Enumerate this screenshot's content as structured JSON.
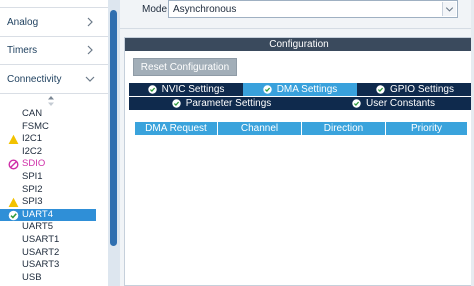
{
  "sidebar": {
    "categories": [
      {
        "label": "Analog"
      },
      {
        "label": "Timers"
      },
      {
        "label": "Connectivity"
      }
    ],
    "peripherals": [
      {
        "label": "CAN",
        "status": "none"
      },
      {
        "label": "FSMC",
        "status": "none"
      },
      {
        "label": "I2C1",
        "status": "warning"
      },
      {
        "label": "I2C2",
        "status": "none"
      },
      {
        "label": "SDIO",
        "status": "disabled"
      },
      {
        "label": "SPI1",
        "status": "none"
      },
      {
        "label": "SPI2",
        "status": "none"
      },
      {
        "label": "SPI3",
        "status": "warning"
      },
      {
        "label": "UART4",
        "status": "configured",
        "selected": true
      },
      {
        "label": "UART5",
        "status": "none"
      },
      {
        "label": "USART1",
        "status": "none"
      },
      {
        "label": "USART2",
        "status": "none"
      },
      {
        "label": "USART3",
        "status": "none"
      },
      {
        "label": "USB",
        "status": "none"
      }
    ]
  },
  "mode": {
    "label": "Mode",
    "value": "Asynchronous"
  },
  "configuration": {
    "title": "Configuration",
    "reset_label": "Reset Configuration",
    "tabs": [
      {
        "label": "NVIC Settings",
        "active": false
      },
      {
        "label": "DMA Settings",
        "active": true
      },
      {
        "label": "GPIO Settings",
        "active": false
      },
      {
        "label": "Parameter Settings",
        "active": false
      },
      {
        "label": "User Constants",
        "active": false
      }
    ],
    "table_columns": [
      "DMA Request",
      "Channel",
      "Direction",
      "Priority"
    ]
  },
  "colors": {
    "selected": "#2f8fd7",
    "tab_dark": "#0f2a4d",
    "tab_active": "#39a1dc",
    "warning": "#f2c200",
    "disabled": "#cf2fa8"
  }
}
